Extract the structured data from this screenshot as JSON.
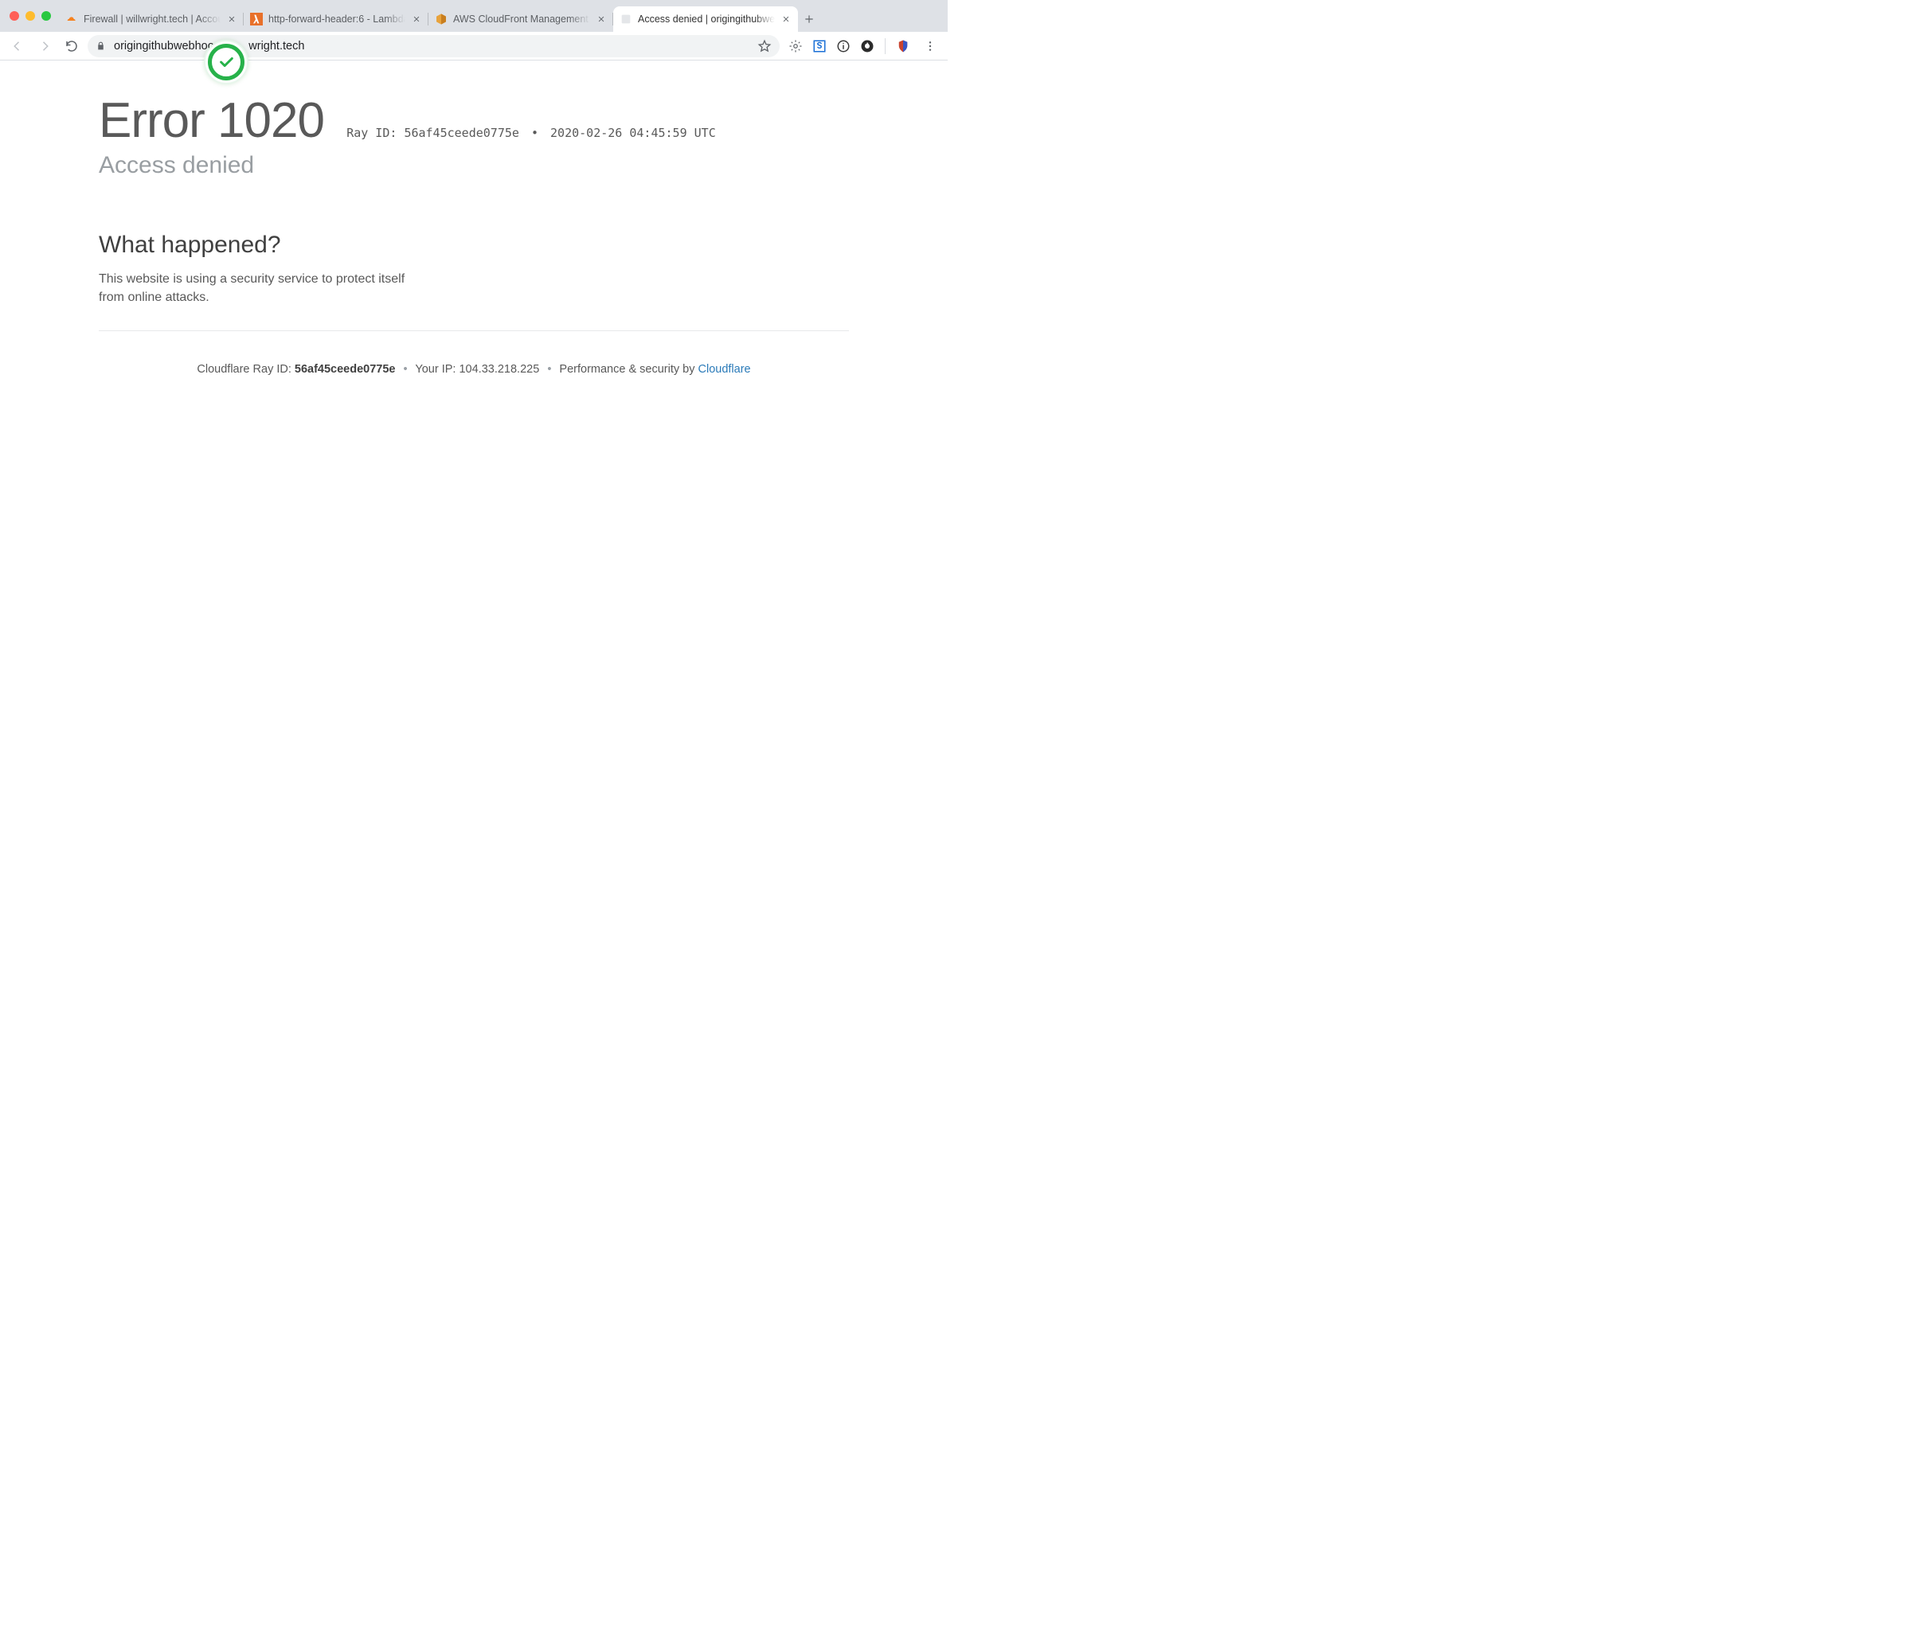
{
  "tabs": [
    {
      "title": "Firewall | willwright.tech | Accou",
      "icon": "cloudflare"
    },
    {
      "title": "http-forward-header:6 - Lambda",
      "icon": "lambda"
    },
    {
      "title": "AWS CloudFront Management C",
      "icon": "aws"
    },
    {
      "title": "Access denied | origingithubweb",
      "icon": "blank",
      "active": true
    }
  ],
  "omnibox": {
    "url_left": "origingithubwebhoo",
    "url_right": "wright.tech"
  },
  "error": {
    "code_prefix": "Error",
    "code": "1020",
    "ray_label": "Ray ID:",
    "ray_id": "56af45ceede0775e",
    "timestamp": "2020-02-26 04:45:59 UTC",
    "subtitle": "Access denied",
    "section_heading": "What happened?",
    "section_body": "This website is using a security service to protect itself from online attacks."
  },
  "footer": {
    "ray_label": "Cloudflare Ray ID:",
    "ray_id": "56af45ceede0775e",
    "ip_label": "Your IP:",
    "ip": "104.33.218.225",
    "perf_label": "Performance & security by",
    "perf_link": "Cloudflare"
  }
}
